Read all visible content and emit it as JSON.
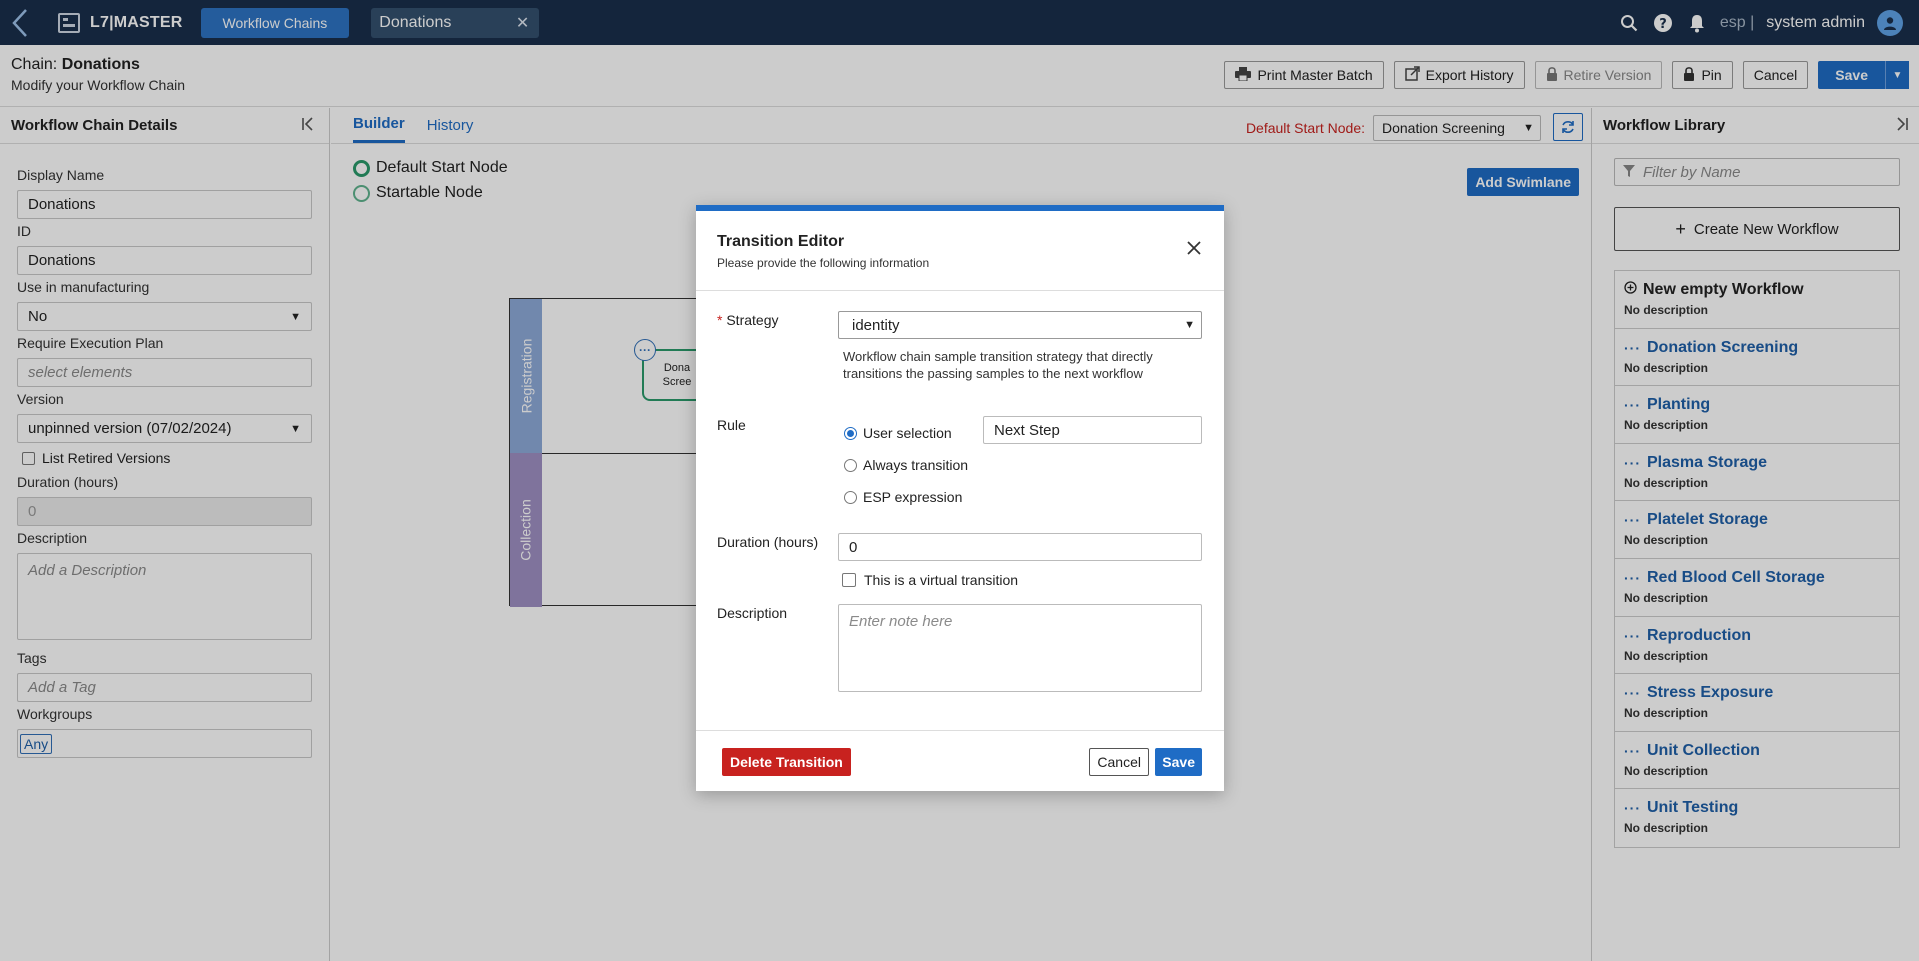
{
  "topbar": {
    "brand": "L7|MASTER",
    "nav_tab": "Workflow Chains",
    "open_tab": "Donations",
    "env": "esp |",
    "user": "system admin"
  },
  "header": {
    "chain_prefix": "Chain:",
    "chain_name": "Donations",
    "subtitle": "Modify your Workflow Chain",
    "actions": {
      "print": "Print Master Batch",
      "export": "Export History",
      "retire": "Retire Version",
      "pin": "Pin",
      "cancel": "Cancel",
      "save": "Save"
    }
  },
  "left": {
    "title": "Workflow Chain Details",
    "display_name_label": "Display Name",
    "display_name": "Donations",
    "id_label": "ID",
    "id": "Donations",
    "use_mfg_label": "Use in manufacturing",
    "use_mfg": "No",
    "req_exec_label": "Require Execution Plan",
    "req_exec_placeholder": "select elements",
    "version_label": "Version",
    "version": "unpinned version (07/02/2024)",
    "list_retired": "List Retired Versions",
    "duration_label": "Duration (hours)",
    "duration": "0",
    "description_label": "Description",
    "description_placeholder": "Add a Description",
    "tags_label": "Tags",
    "tags_placeholder": "Add a Tag",
    "workgroups_label": "Workgroups",
    "workgroup": "Any"
  },
  "center": {
    "tabs": [
      "Builder",
      "History"
    ],
    "default_start_label": "Default Start Node:",
    "default_start_value": "Donation Screening",
    "legend_default": "Default Start Node",
    "legend_startable": "Startable Node",
    "add_swimlane": "Add Swimlane",
    "lanes": [
      "Registration",
      "Collection"
    ],
    "node_label_1": "Dona",
    "node_label_2": "Scree",
    "colors": {
      "lane1": "#8eaad9",
      "lane2": "#9f90c4"
    }
  },
  "right": {
    "title": "Workflow Library",
    "filter_placeholder": "Filter by Name",
    "create": "Create New Workflow",
    "items": [
      {
        "name": "New empty Workflow",
        "desc": "No description"
      },
      {
        "name": "Donation Screening",
        "desc": "No description"
      },
      {
        "name": "Planting",
        "desc": "No description"
      },
      {
        "name": "Plasma Storage",
        "desc": "No description"
      },
      {
        "name": "Platelet Storage",
        "desc": "No description"
      },
      {
        "name": "Red Blood Cell Storage",
        "desc": "No description"
      },
      {
        "name": "Reproduction",
        "desc": "No description"
      },
      {
        "name": "Stress Exposure",
        "desc": "No description"
      },
      {
        "name": "Unit Collection",
        "desc": "No description"
      },
      {
        "name": "Unit Testing",
        "desc": "No description"
      }
    ]
  },
  "modal": {
    "title": "Transition Editor",
    "subtitle": "Please provide the following information",
    "strategy_label": "Strategy",
    "strategy": "identity",
    "strategy_help": "Workflow chain sample transition strategy that directly transitions the passing samples to the next workflow",
    "rule_label": "Rule",
    "rule_user": "User selection",
    "rule_always": "Always transition",
    "rule_esp": "ESP expression",
    "rule_value": "Next Step",
    "duration_label": "Duration (hours)",
    "duration": "0",
    "virtual": "This is a virtual transition",
    "description_label": "Description",
    "description_placeholder": "Enter note here",
    "delete": "Delete Transition",
    "cancel": "Cancel",
    "save": "Save"
  }
}
